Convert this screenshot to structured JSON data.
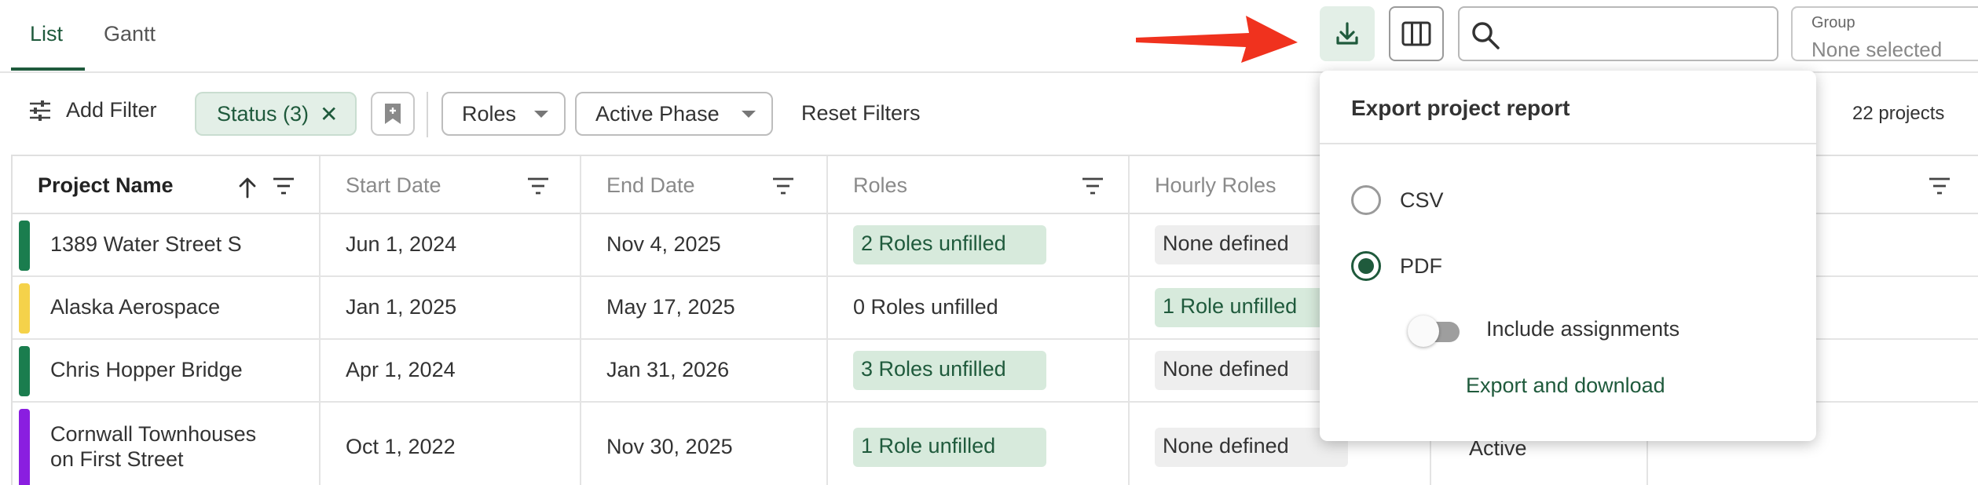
{
  "tabs": {
    "list": "List",
    "gantt": "Gantt"
  },
  "toolbar": {
    "search_placeholder": "",
    "group_label": "Group",
    "group_value": "None selected"
  },
  "filters": {
    "add_filter": "Add Filter",
    "status_chip": "Status (3)",
    "roles": "Roles",
    "active_phase": "Active Phase",
    "reset": "Reset Filters",
    "project_count": "22 projects"
  },
  "table": {
    "headers": [
      "Project Name",
      "Start Date",
      "End Date",
      "Roles",
      "Hourly Roles"
    ],
    "rows": [
      {
        "name": [
          "1389 Water Street S"
        ],
        "color": "#1a7d4e",
        "start": "Jun 1, 2024",
        "end": "Nov 4, 2025",
        "roles": "2 Roles unfilled",
        "roles_badge": true,
        "hourly": "None defined",
        "hourly_badge": "grey",
        "extra": ""
      },
      {
        "name": [
          "Alaska Aerospace"
        ],
        "color": "#f5d24a",
        "start": "Jan 1, 2025",
        "end": "May 17, 2025",
        "roles": "0 Roles unfilled",
        "roles_badge": false,
        "hourly": "1 Role unfilled",
        "hourly_badge": "green",
        "extra": ""
      },
      {
        "name": [
          "Chris Hopper Bridge"
        ],
        "color": "#1a7d4e",
        "start": "Apr 1, 2024",
        "end": "Jan 31, 2026",
        "roles": "3 Roles unfilled",
        "roles_badge": true,
        "hourly": "None defined",
        "hourly_badge": "grey",
        "extra": ""
      },
      {
        "name": [
          "Cornwall Townhouses",
          "on First Street"
        ],
        "color": "#8a1ee0",
        "start": "Oct 1, 2022",
        "end": "Nov 30, 2025",
        "roles": "1 Role unfilled",
        "roles_badge": true,
        "hourly": "None defined",
        "hourly_badge": "grey",
        "extra": "Active"
      }
    ]
  },
  "export_popover": {
    "title": "Export project report",
    "option_csv": "CSV",
    "option_pdf": "PDF",
    "selected": "PDF",
    "include_assignments": "Include assignments",
    "include_assignments_on": false,
    "action": "Export and download"
  },
  "colors": {
    "accent": "#1f5a3c",
    "accent_bg": "#e3efe7",
    "arrow": "#f0321e"
  }
}
